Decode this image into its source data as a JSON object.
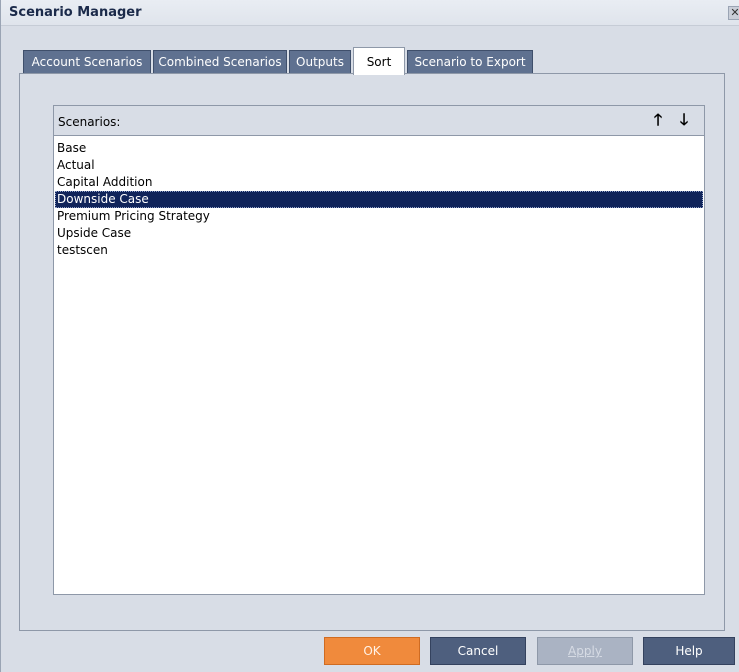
{
  "window": {
    "title": "Scenario Manager",
    "close_glyph": "✕"
  },
  "tabs": [
    {
      "label": "Account Scenarios",
      "active": false
    },
    {
      "label": "Combined Scenarios",
      "active": false
    },
    {
      "label": "Outputs",
      "active": false
    },
    {
      "label": "Sort",
      "active": true
    },
    {
      "label": "Scenario to Export",
      "active": false
    }
  ],
  "scenarios": {
    "header": "Scenarios:",
    "move_up_glyph": "🡑",
    "move_down_glyph": "🡓",
    "items": [
      "Base",
      "Actual",
      "Capital Addition",
      "Downside Case",
      "Premium Pricing Strategy",
      "Upside Case",
      "testscen"
    ],
    "selected_index": 3
  },
  "footer": {
    "ok_label": "OK",
    "cancel_label": "Cancel",
    "apply_label": "Apply",
    "help_label": "Help"
  },
  "colors": {
    "tab_bg": "#5f7190",
    "selection": "#10245a",
    "primary_button": "#f08a3c",
    "button": "#4e5f7e"
  }
}
